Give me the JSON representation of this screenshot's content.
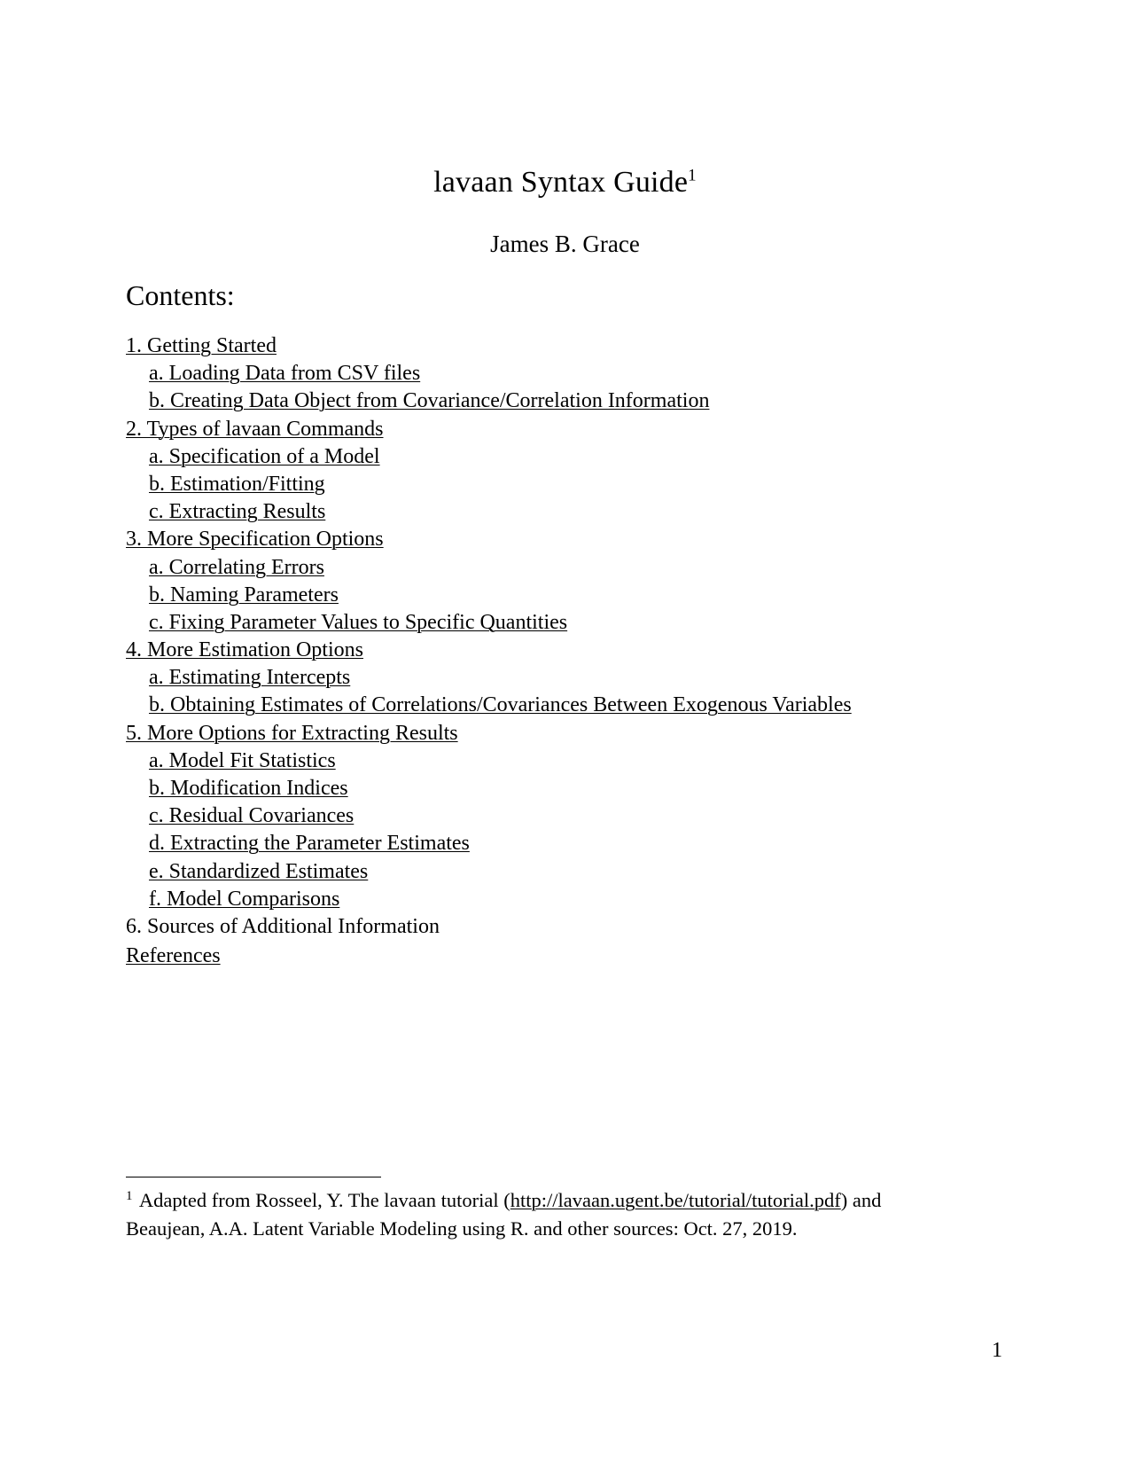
{
  "document": {
    "title": "lavaan Syntax Guide",
    "title_footnote_marker": "1",
    "author": "James B. Grace",
    "contents_heading": "Contents:",
    "page_number": "1"
  },
  "toc": {
    "entries": [
      {
        "marker": "1.",
        "label": "Getting Started",
        "level": 1,
        "link": true
      },
      {
        "marker": "a.",
        "label": "Loading Data from CSV files",
        "level": 2,
        "link": true
      },
      {
        "marker": "b.",
        "label": "Creating Data Object from Covariance/Correlation Information",
        "level": 2,
        "link": true
      },
      {
        "marker": "2.",
        "label": "Types of lavaan Commands",
        "level": 1,
        "link": true
      },
      {
        "marker": "a.",
        "label": "Specification of a Model",
        "level": 2,
        "link": true
      },
      {
        "marker": "b.",
        "label": "Estimation/Fitting",
        "level": 2,
        "link": true
      },
      {
        "marker": "c.",
        "label": "Extracting Results",
        "level": 2,
        "link": true
      },
      {
        "marker": "3.",
        "label": "More Specification Options",
        "level": 1,
        "link": true
      },
      {
        "marker": "a.",
        "label": "Correlating Errors",
        "level": 2,
        "link": true
      },
      {
        "marker": "b.",
        "label": "Naming Parameters",
        "level": 2,
        "link": true
      },
      {
        "marker": "c.",
        "label": "Fixing Parameter Values to Specific Quantities",
        "level": 2,
        "link": true
      },
      {
        "marker": "4.",
        "label": "More Estimation Options",
        "level": 1,
        "link": true
      },
      {
        "marker": "a.",
        "label": "Estimating Intercepts",
        "level": 2,
        "link": true
      },
      {
        "marker": "b.",
        "label": "Obtaining Estimates of Correlations/Covariances Between Exogenous Variables",
        "level": 2,
        "link": true
      },
      {
        "marker": "5.",
        "label": "More Options for Extracting Results",
        "level": 1,
        "link": true
      },
      {
        "marker": "a.",
        "label": "Model Fit Statistics",
        "level": 2,
        "link": true
      },
      {
        "marker": "b.",
        "label": "Modification Indices",
        "level": 2,
        "link": true
      },
      {
        "marker": "c.",
        "label": "Residual Covariances",
        "level": 2,
        "link": true
      },
      {
        "marker": "d.",
        "label": "Extracting the Parameter Estimates",
        "level": 2,
        "link": true
      },
      {
        "marker": "e.",
        "label": "Standardized Estimates",
        "level": 2,
        "link": true
      },
      {
        "marker": "f.",
        "label": "Model Comparisons",
        "level": 2,
        "link": true
      },
      {
        "marker": "6.",
        "label": "Sources of Additional Information",
        "level": 1,
        "link": false
      }
    ],
    "references_label": "References"
  },
  "footnote": {
    "marker": "1",
    "text_before_url": " Adapted from Rosseel, Y. The lavaan tutorial (",
    "url": "http://lavaan.ugent.be/tutorial/tutorial.pdf",
    "text_after_url": ") and Beaujean, A.A. Latent Variable Modeling using R. and other sources: Oct. 27, 2019."
  }
}
